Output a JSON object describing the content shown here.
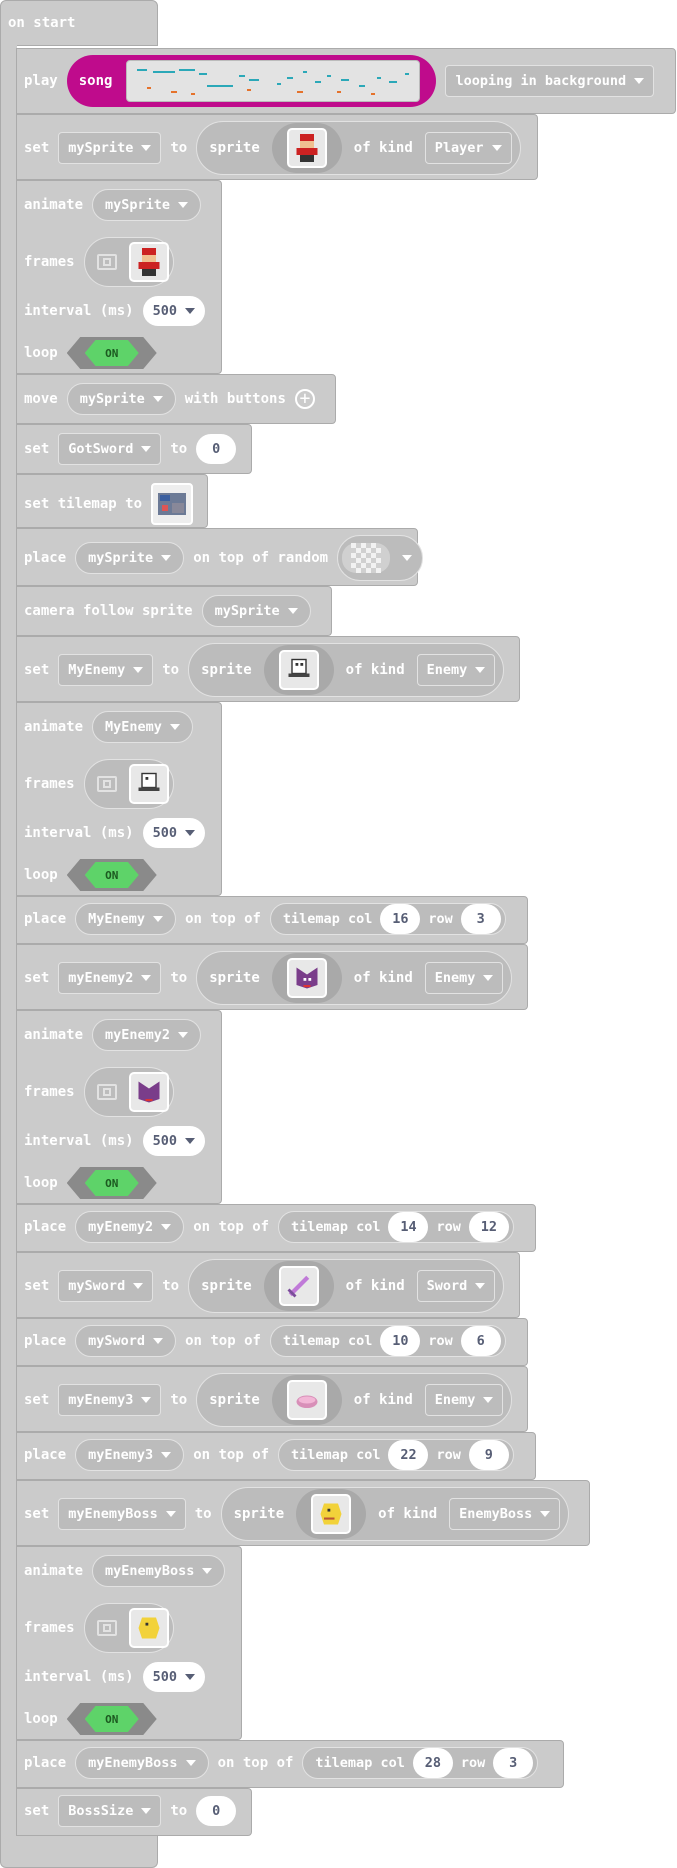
{
  "workspace": {
    "hat_label": "on start",
    "play": {
      "label": "play",
      "song_label": "song",
      "mode": "looping in background"
    },
    "set_player": {
      "set": "set",
      "var": "mySprite",
      "to": "to",
      "sprite": "sprite",
      "of_kind": "of kind",
      "kind": "Player",
      "icon": "player-sprite-icon"
    },
    "anim1": {
      "animate": "animate",
      "var": "mySprite",
      "frames": "frames",
      "interval": "interval (ms)",
      "ms": "500",
      "loop": "loop",
      "on": "ON"
    },
    "move": {
      "label": "move",
      "var": "mySprite",
      "with": "with buttons"
    },
    "gotsword": {
      "set": "set",
      "var": "GotSword",
      "to": "to",
      "value": "0"
    },
    "tilemap": {
      "label": "set tilemap to"
    },
    "place_random": {
      "place": "place",
      "var": "mySprite",
      "label": "on top of random"
    },
    "camera": {
      "label": "camera follow sprite",
      "var": "mySprite"
    },
    "set_enemy": {
      "set": "set",
      "var": "MyEnemy",
      "to": "to",
      "sprite": "sprite",
      "of_kind": "of kind",
      "kind": "Enemy"
    },
    "anim2": {
      "animate": "animate",
      "var": "MyEnemy",
      "frames": "frames",
      "interval": "interval (ms)",
      "ms": "500",
      "loop": "loop",
      "on": "ON"
    },
    "place_enemy": {
      "place": "place",
      "var": "MyEnemy",
      "ontop": "on top of",
      "tilemap": "tilemap col",
      "col": "16",
      "row_label": "row",
      "row": "3"
    },
    "set_enemy2": {
      "set": "set",
      "var": "myEnemy2",
      "to": "to",
      "sprite": "sprite",
      "of_kind": "of kind",
      "kind": "Enemy"
    },
    "anim3": {
      "animate": "animate",
      "var": "myEnemy2",
      "frames": "frames",
      "interval": "interval (ms)",
      "ms": "500",
      "loop": "loop",
      "on": "ON"
    },
    "place_enemy2": {
      "place": "place",
      "var": "myEnemy2",
      "ontop": "on top of",
      "tilemap": "tilemap col",
      "col": "14",
      "row_label": "row",
      "row": "12"
    },
    "set_sword": {
      "set": "set",
      "var": "mySword",
      "to": "to",
      "sprite": "sprite",
      "of_kind": "of kind",
      "kind": "Sword"
    },
    "place_sword": {
      "place": "place",
      "var": "mySword",
      "ontop": "on top of",
      "tilemap": "tilemap col",
      "col": "10",
      "row_label": "row",
      "row": "6"
    },
    "set_enemy3": {
      "set": "set",
      "var": "myEnemy3",
      "to": "to",
      "sprite": "sprite",
      "of_kind": "of kind",
      "kind": "Enemy"
    },
    "place_enemy3": {
      "place": "place",
      "var": "myEnemy3",
      "ontop": "on top of",
      "tilemap": "tilemap col",
      "col": "22",
      "row_label": "row",
      "row": "9"
    },
    "set_boss": {
      "set": "set",
      "var": "myEnemyBoss",
      "to": "to",
      "sprite": "sprite",
      "of_kind": "of kind",
      "kind": "EnemyBoss"
    },
    "anim4": {
      "animate": "animate",
      "var": "myEnemyBoss",
      "frames": "frames",
      "interval": "interval (ms)",
      "ms": "500",
      "loop": "loop",
      "on": "ON"
    },
    "place_boss": {
      "place": "place",
      "var": "myEnemyBoss",
      "ontop": "on top of",
      "tilemap": "tilemap col",
      "col": "28",
      "row_label": "row",
      "row": "3"
    },
    "bosssize": {
      "set": "set",
      "var": "BossSize",
      "to": "to",
      "value": "0"
    }
  },
  "colors": {
    "block": "#cbcbcb",
    "song": "#bf0b8c",
    "toggle_on": "#5ed369"
  }
}
